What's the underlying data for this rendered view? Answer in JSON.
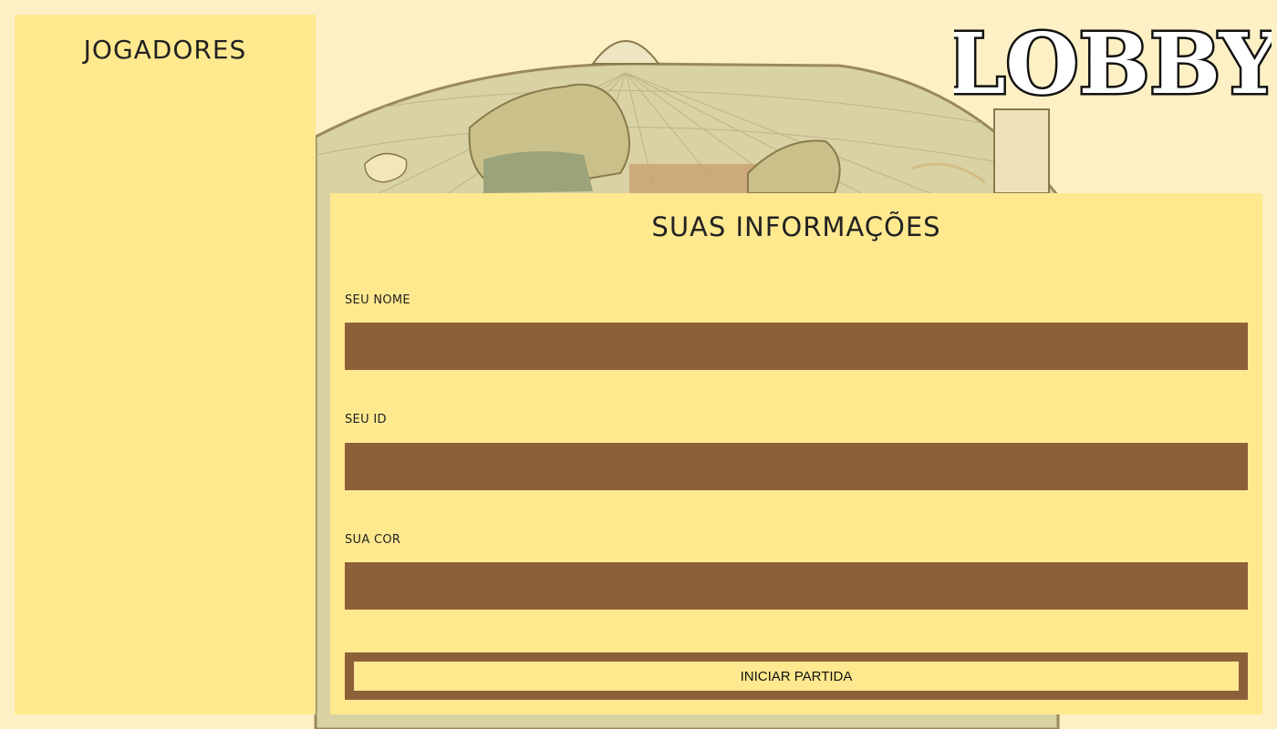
{
  "players": {
    "title": "JOGADORES",
    "list": []
  },
  "logo": {
    "text": "LOBBY"
  },
  "form": {
    "title": "SUAS INFORMAÇÕES",
    "name_label": "SEU NOME",
    "name_value": "",
    "id_label": "SEU ID",
    "id_value": "",
    "color_label": "SUA COR",
    "color_value": "",
    "start_label": "INICIAR PARTIDA"
  },
  "colors": {
    "panel": "#ffe98f",
    "input": "#8e603a",
    "background": "#fdf0c4"
  },
  "icons": {
    "background": "world-map-illustration"
  }
}
